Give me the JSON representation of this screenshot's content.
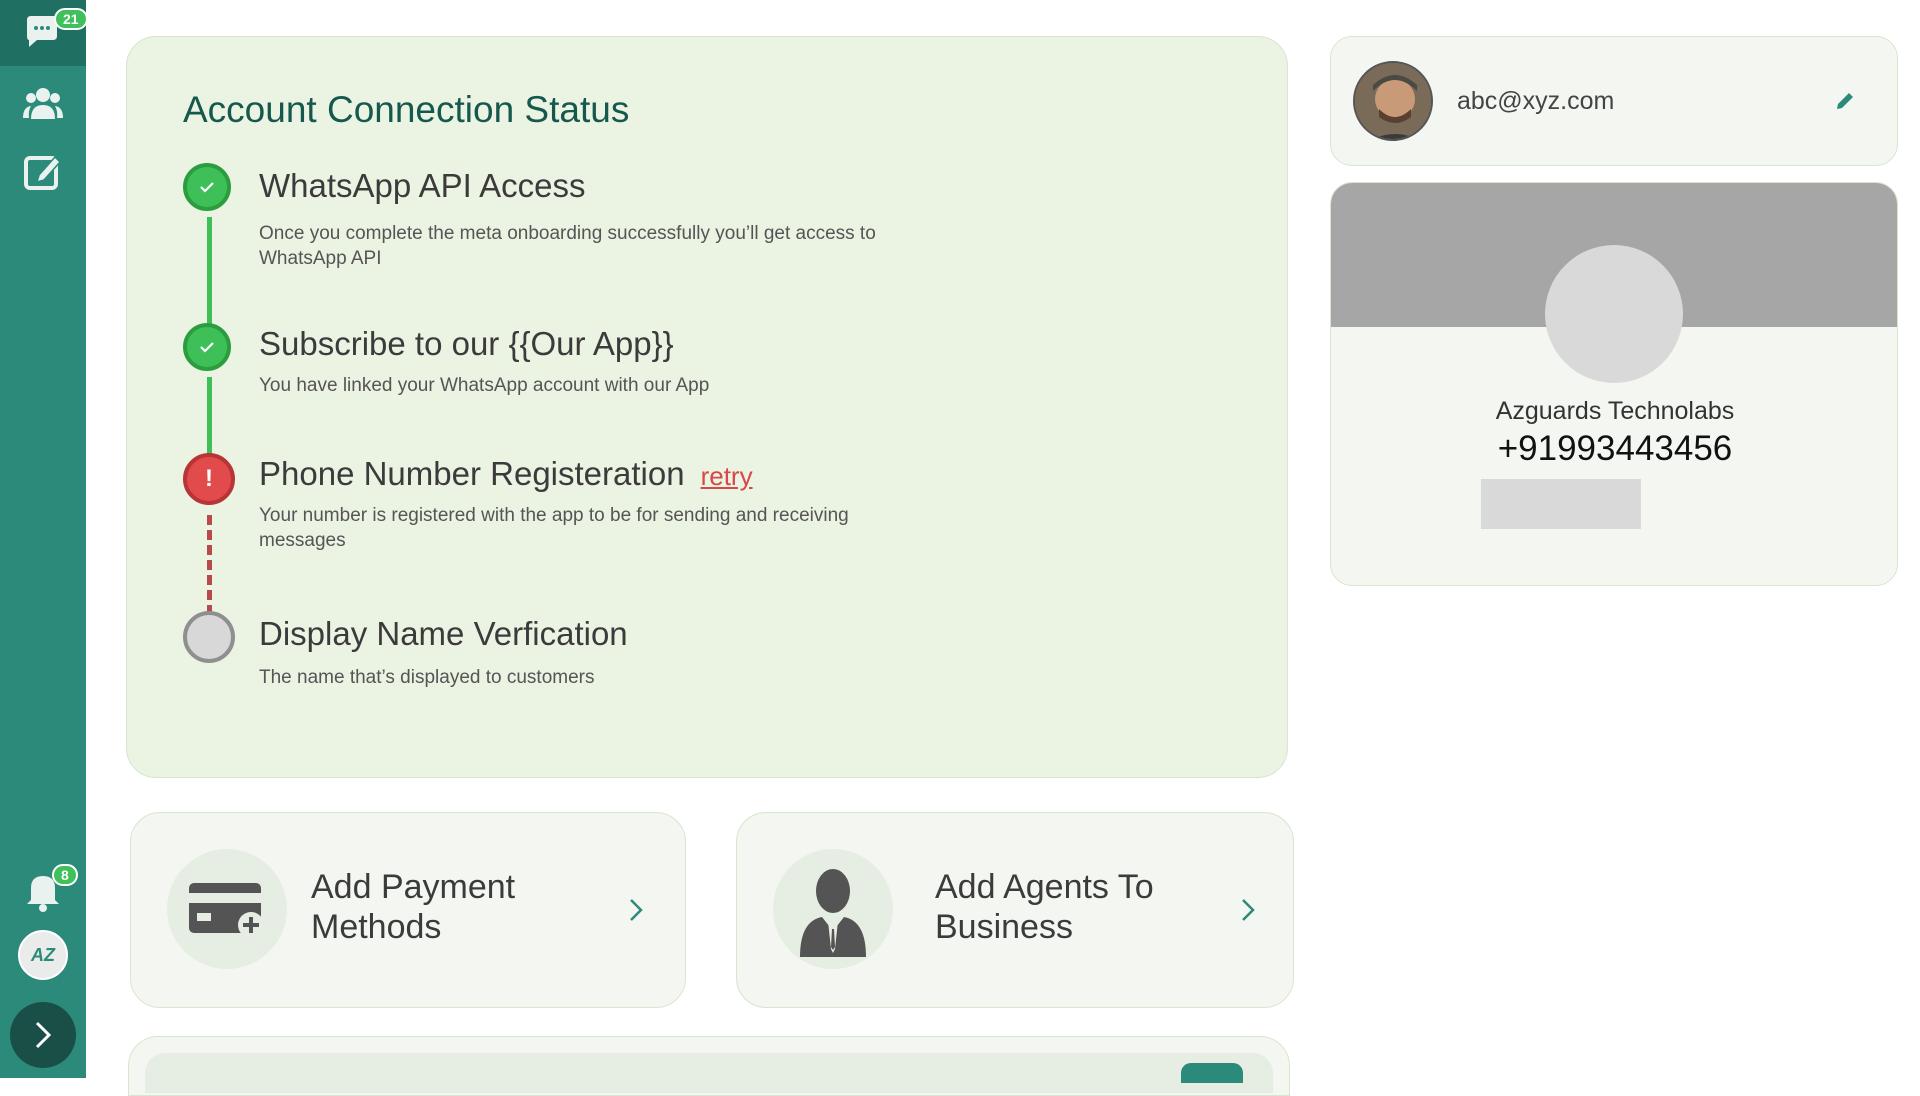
{
  "sidebar": {
    "chat_badge": "21",
    "notification_badge": "8",
    "logo_text": "AZ",
    "icons": [
      "chat-icon",
      "contacts-icon",
      "edit-icon",
      "bell-icon",
      "expand-icon"
    ]
  },
  "status": {
    "title": "Account Connection Status",
    "steps": [
      {
        "title": "WhatsApp API Access",
        "desc": "Once you complete the meta onboarding successfully you’ll get access to WhatsApp API",
        "state": "done"
      },
      {
        "title": "Subscribe to our {{Our App}}",
        "desc": "You have linked your WhatsApp account with our App",
        "state": "done"
      },
      {
        "title": "Phone Number Registeration",
        "action": "retry",
        "desc": "Your number is registered with the app to be for sending and receiving messages",
        "state": "error",
        "marker": "!"
      },
      {
        "title": "Display Name Verfication",
        "desc": "The name that’s displayed to customers",
        "state": "pending"
      }
    ]
  },
  "actions": [
    {
      "label": "Add Payment Methods",
      "icon": "credit-card-add-icon"
    },
    {
      "label": "Add Agents To Business",
      "icon": "agent-person-icon"
    }
  ],
  "profile": {
    "email": "abc@xyz.com"
  },
  "business": {
    "name": "Azguards Technolabs",
    "phone": "+91993443456"
  },
  "colors": {
    "sidebar": "#2c8a7b",
    "accent": "#17584e",
    "success": "#3fbf57",
    "error": "#e24b4b",
    "card": "#ebf3e3"
  }
}
